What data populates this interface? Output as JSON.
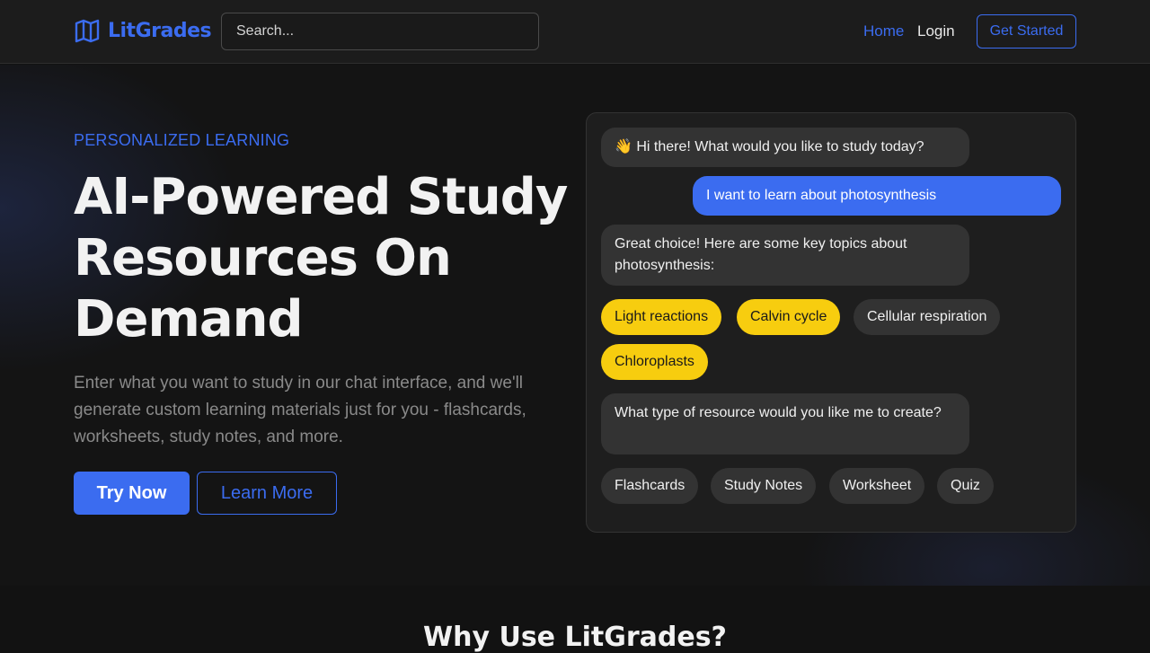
{
  "navbar": {
    "brand": "LitGrades",
    "logo_icon": "open-book-icon",
    "search_placeholder": "Search...",
    "links": {
      "home": "Home",
      "login": "Login"
    },
    "cta": "Get Started"
  },
  "hero": {
    "eyebrow": "PERSONALIZED LEARNING",
    "headline": "AI-Powered Study Resources On Demand",
    "subtext": "Enter what you want to study in our chat interface, and we'll generate custom learning materials just for you - flashcards, worksheets, study notes, and more.",
    "primary_button": "Try Now",
    "secondary_button": "Learn More"
  },
  "chat": {
    "messages": [
      "👋 Hi there! What would you like to study today?",
      "I want to learn about photosynthesis",
      "Great choice! Here are some key topics about photosynthesis:",
      "What type of resource would you like me to create?"
    ],
    "topic_chips": [
      "Light reactions",
      "Calvin cycle",
      "Cellular respiration",
      "Chloroplasts"
    ],
    "resource_chips": [
      "Flashcards",
      "Study Notes",
      "Worksheet",
      "Quiz"
    ]
  },
  "features": {
    "title": "Why Use LitGrades?"
  },
  "colors": {
    "accent": "#3b6cf0",
    "chip_highlight": "#f7cd0f",
    "background": "#121212"
  }
}
